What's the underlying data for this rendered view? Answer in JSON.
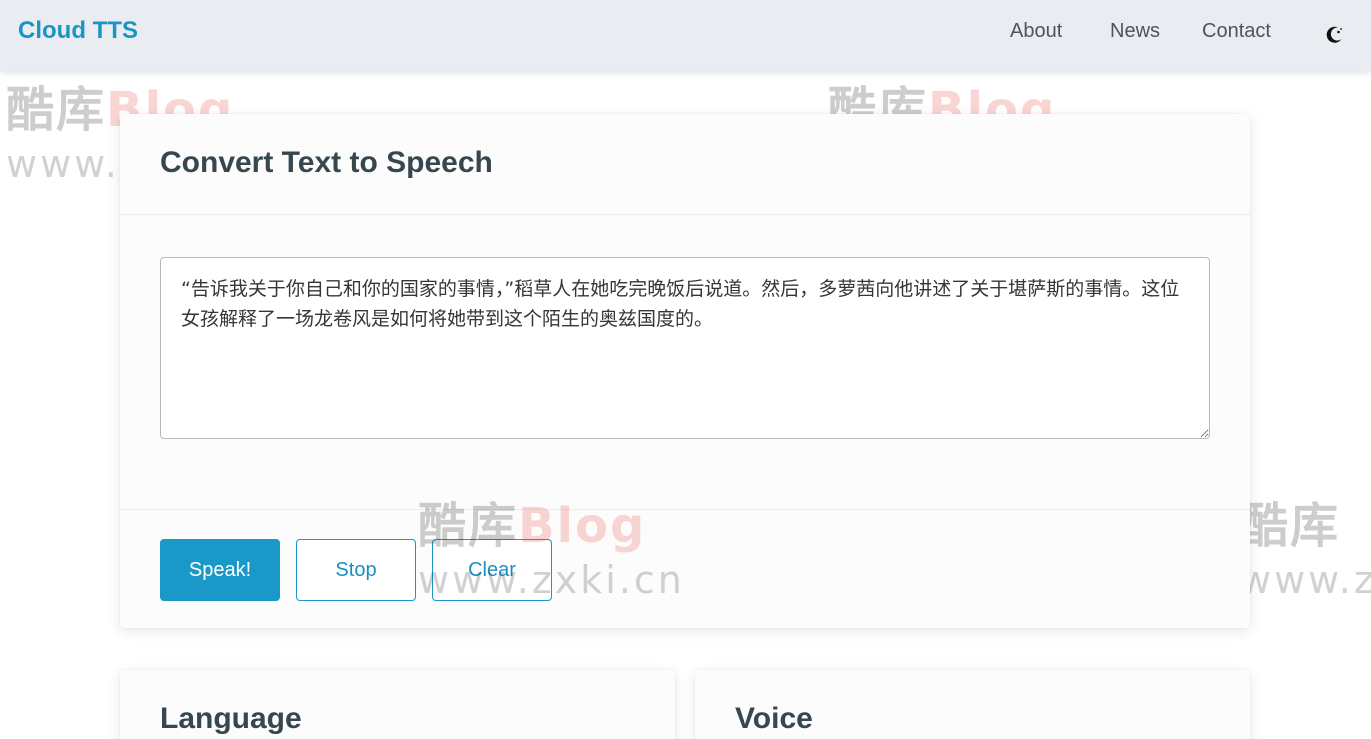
{
  "nav": {
    "brand": "Cloud TTS",
    "links": [
      "About",
      "News",
      "Contact"
    ],
    "theme_icon": "moon-icon"
  },
  "watermark": {
    "brand_cn": "酷库",
    "brand_en": "Blog",
    "url": "www.zxki.cn"
  },
  "main": {
    "title": "Convert Text to Speech",
    "text": "“告诉我关于你自己和你的国家的事情，”稻草人在她吃完晚饭后说道。然后，多萝茜向他讲述了关于堪萨斯的事情。这位女孩解释了一场龙卷风是如何将她带到这个陌生的奥兹国度的。",
    "buttons": {
      "speak": "Speak!",
      "stop": "Stop",
      "clear": "Clear"
    }
  },
  "sections": {
    "language": "Language",
    "voice": "Voice"
  },
  "colors": {
    "accent": "#1a98c7",
    "navbar_bg": "#e9edf2",
    "title": "#37474f"
  }
}
